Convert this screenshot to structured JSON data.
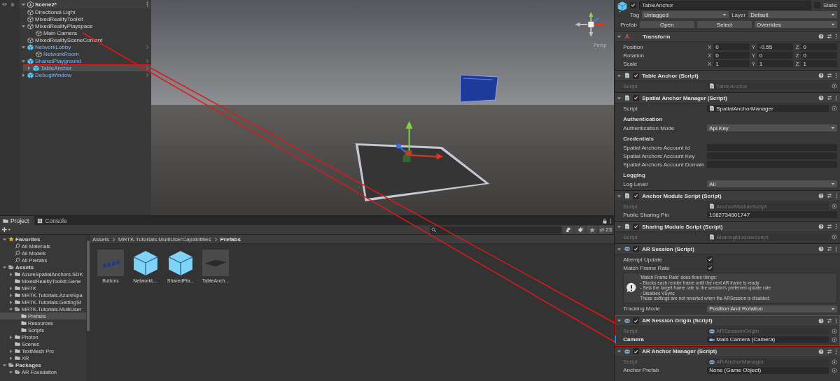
{
  "hierarchy": {
    "scene": "Scene2*",
    "items": [
      {
        "label": "Directional Light",
        "kind": "object",
        "selected": false,
        "highlighted": false
      },
      {
        "label": "MixedRealityToolkit",
        "kind": "object",
        "selected": false,
        "highlighted": false
      },
      {
        "label": "MixedRealityPlayspace",
        "kind": "object",
        "expanded": true,
        "selected": false,
        "highlighted": false,
        "children": [
          {
            "label": "Main Camera",
            "kind": "object",
            "selected": false,
            "highlighted": false
          }
        ]
      },
      {
        "label": "MixedRealitySceneContent",
        "kind": "object",
        "selected": false,
        "highlighted": false
      },
      {
        "label": "NetworkLobby",
        "kind": "prefab_root",
        "expanded": true,
        "selected": false,
        "highlighted": false,
        "children": [
          {
            "label": "NetworkRoom",
            "kind": "prefab_child",
            "selected": false,
            "highlighted": false
          }
        ]
      },
      {
        "label": "SharedPlayground",
        "kind": "prefab_root",
        "expanded": true,
        "selected": false,
        "highlighted": false,
        "children": [
          {
            "label": "TableAnchor",
            "kind": "prefab_root",
            "expanded": false,
            "selected": true,
            "highlighted": true
          }
        ]
      },
      {
        "label": "DebugWindow",
        "kind": "prefab_root",
        "expanded": false,
        "selected": false,
        "highlighted": false
      }
    ]
  },
  "scene_view": {
    "camera_label": "Persp"
  },
  "project": {
    "tabs": [
      {
        "label": "Project",
        "selected": true
      },
      {
        "label": "Console",
        "selected": false
      }
    ],
    "hidden_count": "23",
    "tree": [
      {
        "label": "Favorites",
        "kind": "favorites",
        "expanded": true,
        "bold": true,
        "selected": false,
        "children": [
          {
            "label": "All Materials",
            "kind": "saved_search",
            "bold": false,
            "selected": false
          },
          {
            "label": "All Models",
            "kind": "saved_search",
            "bold": false,
            "selected": false
          },
          {
            "label": "All Prefabs",
            "kind": "saved_search",
            "bold": false,
            "selected": false
          }
        ]
      },
      {
        "label": "Assets",
        "kind": "folder",
        "expanded": true,
        "bold": true,
        "selected": false,
        "children": [
          {
            "label": "AzureSpatialAnchors.SDK",
            "kind": "folder",
            "expanded": false,
            "bold": false,
            "selected": false
          },
          {
            "label": "MixedRealityToolkit.Gene",
            "kind": "folder",
            "bold": false,
            "selected": false
          },
          {
            "label": "MRTK",
            "kind": "folder",
            "expanded": false,
            "bold": false,
            "selected": false
          },
          {
            "label": "MRTK.Tutorials.AzureSpa",
            "kind": "folder",
            "expanded": false,
            "bold": false,
            "selected": false
          },
          {
            "label": "MRTK.Tutorials.GettingSt",
            "kind": "folder",
            "expanded": false,
            "bold": false,
            "selected": false
          },
          {
            "label": "MRTK.Tutorials.MultiUser",
            "kind": "folder",
            "expanded": true,
            "bold": false,
            "selected": false,
            "children": [
              {
                "label": "Prefabs",
                "kind": "folder",
                "bold": false,
                "selected": true
              },
              {
                "label": "Resources",
                "kind": "folder",
                "bold": false,
                "selected": false
              },
              {
                "label": "Scripts",
                "kind": "folder",
                "bold": false,
                "selected": false
              }
            ]
          },
          {
            "label": "Photon",
            "kind": "folder",
            "expanded": false,
            "bold": false,
            "selected": false
          },
          {
            "label": "Scenes",
            "kind": "folder",
            "bold": false,
            "selected": false
          },
          {
            "label": "TextMesh Pro",
            "kind": "folder",
            "expanded": false,
            "bold": false,
            "selected": false
          },
          {
            "label": "XR",
            "kind": "folder",
            "expanded": false,
            "bold": false,
            "selected": false
          }
        ]
      },
      {
        "label": "Packages",
        "kind": "folder",
        "expanded": true,
        "bold": true,
        "selected": false,
        "children": [
          {
            "label": "AR Foundation",
            "kind": "folder",
            "expanded": true,
            "bold": false,
            "selected": false
          }
        ]
      }
    ],
    "breadcrumb": [
      "Assets",
      "MRTK.Tutorials.MultiUserCapabilities",
      "Prefabs"
    ],
    "assets": [
      {
        "label": "Buttons",
        "kind": "buttons"
      },
      {
        "label": "NetworkL...",
        "kind": "prefab"
      },
      {
        "label": "SharedPla...",
        "kind": "prefab"
      },
      {
        "label": "TableAnch...",
        "kind": "plane"
      }
    ]
  },
  "inspector": {
    "name": "TableAnchor",
    "active": true,
    "static": false,
    "static_label": "Static",
    "tag_label": "Tag",
    "tag": "Untagged",
    "layer_label": "Layer",
    "layer": "Default",
    "prefab_label": "Prefab",
    "prefab_buttons": [
      "Open",
      "Select"
    ],
    "overrides": "Overrides",
    "components": [
      {
        "title": "Transform",
        "kind": "transform",
        "highlighted": false,
        "rows": [
          {
            "kind": "vector",
            "label": "Position",
            "values": [
              {
                "axis": "X",
                "value": "0"
              },
              {
                "axis": "Y",
                "value": "-0.55"
              },
              {
                "axis": "Z",
                "value": "0"
              }
            ]
          },
          {
            "kind": "vector",
            "label": "Rotation",
            "values": [
              {
                "axis": "X",
                "value": "0"
              },
              {
                "axis": "Y",
                "value": "0"
              },
              {
                "axis": "Z",
                "value": "0"
              }
            ]
          },
          {
            "kind": "vector",
            "label": "Scale",
            "values": [
              {
                "axis": "X",
                "value": "1"
              },
              {
                "axis": "Y",
                "value": "1"
              },
              {
                "axis": "Z",
                "value": "1"
              }
            ]
          }
        ]
      },
      {
        "title": "Table Anchor (Script)",
        "kind": "script",
        "enabled": true,
        "highlighted": false,
        "rows": [
          {
            "kind": "script_ref",
            "label": "Script",
            "value": "TableAnchor",
            "disabled": true
          }
        ]
      },
      {
        "title": "Spatial Anchor Manager (Script)",
        "kind": "script",
        "enabled": true,
        "highlighted": false,
        "rows": [
          {
            "kind": "script_ref",
            "label": "Script",
            "value": "SpatialAnchorManager",
            "disabled": false
          },
          {
            "kind": "heading",
            "label": "Authentication"
          },
          {
            "kind": "dropdown",
            "label": "Authentication Mode",
            "value": "Api Key"
          },
          {
            "kind": "heading",
            "label": "Credentials"
          },
          {
            "kind": "text",
            "label": "Spatial Anchors Account Id"
          },
          {
            "kind": "text",
            "label": "Spatial Anchors Account Key"
          },
          {
            "kind": "text",
            "label": "Spatial Anchors Account Domain"
          },
          {
            "kind": "heading",
            "label": "Logging"
          },
          {
            "kind": "dropdown",
            "label": "Log Level",
            "value": "All"
          }
        ]
      },
      {
        "title": "Anchor Module Script (Script)",
        "kind": "script",
        "enabled": true,
        "highlighted": false,
        "rows": [
          {
            "kind": "script_ref",
            "label": "Script",
            "value": "AnchorModuleScript",
            "disabled": true
          },
          {
            "kind": "text",
            "label": "Public Sharing Pin",
            "value": "1982734901747"
          }
        ]
      },
      {
        "title": "Sharing Module Script (Script)",
        "kind": "script",
        "enabled": true,
        "highlighted": false,
        "rows": [
          {
            "kind": "script_ref",
            "label": "Script",
            "value": "SharingModuleScript",
            "disabled": true
          }
        ]
      },
      {
        "title": "AR Session (Script)",
        "kind": "ar",
        "enabled": true,
        "highlighted": false,
        "rows": [
          {
            "kind": "checkbox",
            "label": "Attempt Update",
            "checked": true
          },
          {
            "kind": "checkbox",
            "label": "Match Frame Rate",
            "checked": true
          },
          {
            "kind": "help",
            "lines": [
              "'Match Frame Rate' does three things:",
              "- Blocks each render frame until the next AR frame is ready",
              "- Sets the target frame rate to the session's preferred update rate",
              "- Disables VSync",
              "These settings are not reverted when the ARSession is disabled."
            ]
          },
          {
            "kind": "dropdown",
            "label": "Tracking Mode",
            "value": "Position And Rotation"
          }
        ]
      },
      {
        "title": "AR Session Origin (Script)",
        "kind": "ar",
        "enabled": true,
        "highlighted": true,
        "rows": [
          {
            "kind": "script_ref",
            "label": "Script",
            "value": "ARSessionOrigin",
            "disabled": true,
            "overridden": false
          },
          {
            "kind": "camera_ref",
            "label": "Camera",
            "value": "Main Camera (Camera)",
            "disabled": false,
            "overridden": true
          }
        ]
      },
      {
        "title": "AR Anchor Manager (Script)",
        "kind": "ar",
        "enabled": true,
        "highlighted": false,
        "rows": [
          {
            "kind": "script_ref",
            "label": "Script",
            "value": "ARAnchorManager",
            "disabled": true
          },
          {
            "kind": "empty_ref",
            "label": "Anchor Prefab",
            "value": "None (Game Object)",
            "disabled": false
          }
        ]
      }
    ]
  }
}
